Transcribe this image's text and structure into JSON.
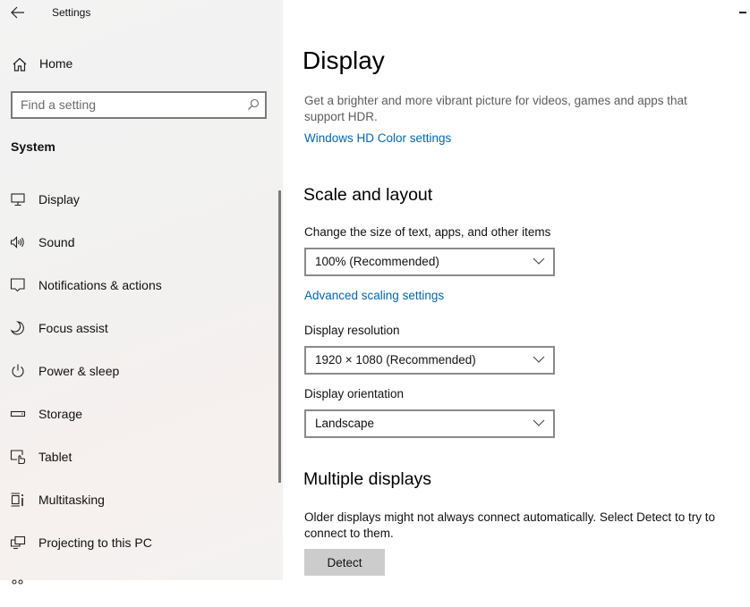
{
  "window": {
    "title": "Settings",
    "back_icon": "arrow-left-icon",
    "minimize_icon": "minimize-icon"
  },
  "sidebar": {
    "home": {
      "label": "Home",
      "icon": "home-icon"
    },
    "search": {
      "placeholder": "Find a setting",
      "value": "",
      "icon": "search-icon"
    },
    "section_title": "System",
    "items": [
      {
        "label": "Display",
        "icon": "monitor-icon",
        "selected": true
      },
      {
        "label": "Sound",
        "icon": "speaker-icon"
      },
      {
        "label": "Notifications & actions",
        "icon": "notification-icon"
      },
      {
        "label": "Focus assist",
        "icon": "moon-icon"
      },
      {
        "label": "Power & sleep",
        "icon": "power-icon"
      },
      {
        "label": "Storage",
        "icon": "storage-icon"
      },
      {
        "label": "Tablet",
        "icon": "tablet-icon"
      },
      {
        "label": "Multitasking",
        "icon": "multitasking-icon"
      },
      {
        "label": "Projecting to this PC",
        "icon": "projecting-icon"
      }
    ]
  },
  "main": {
    "title": "Display",
    "hdr_description": "Get a brighter and more vibrant picture for videos, games and apps that support HDR.",
    "hdr_link": "Windows HD Color settings",
    "scale_layout": {
      "heading": "Scale and layout",
      "scale_label": "Change the size of text, apps, and other items",
      "scale_value": "100% (Recommended)",
      "advanced_link": "Advanced scaling settings",
      "resolution_label": "Display resolution",
      "resolution_value": "1920 × 1080 (Recommended)",
      "orientation_label": "Display orientation",
      "orientation_value": "Landscape"
    },
    "multiple_displays": {
      "heading": "Multiple displays",
      "description": "Older displays might not always connect automatically. Select Detect to try to connect to them.",
      "detect_button": "Detect"
    }
  },
  "colors": {
    "link": "#0067b8",
    "button_bg": "#cccccc",
    "dropdown_border": "#8a8a8a",
    "sidebar_bg": "#f3f3f3"
  }
}
